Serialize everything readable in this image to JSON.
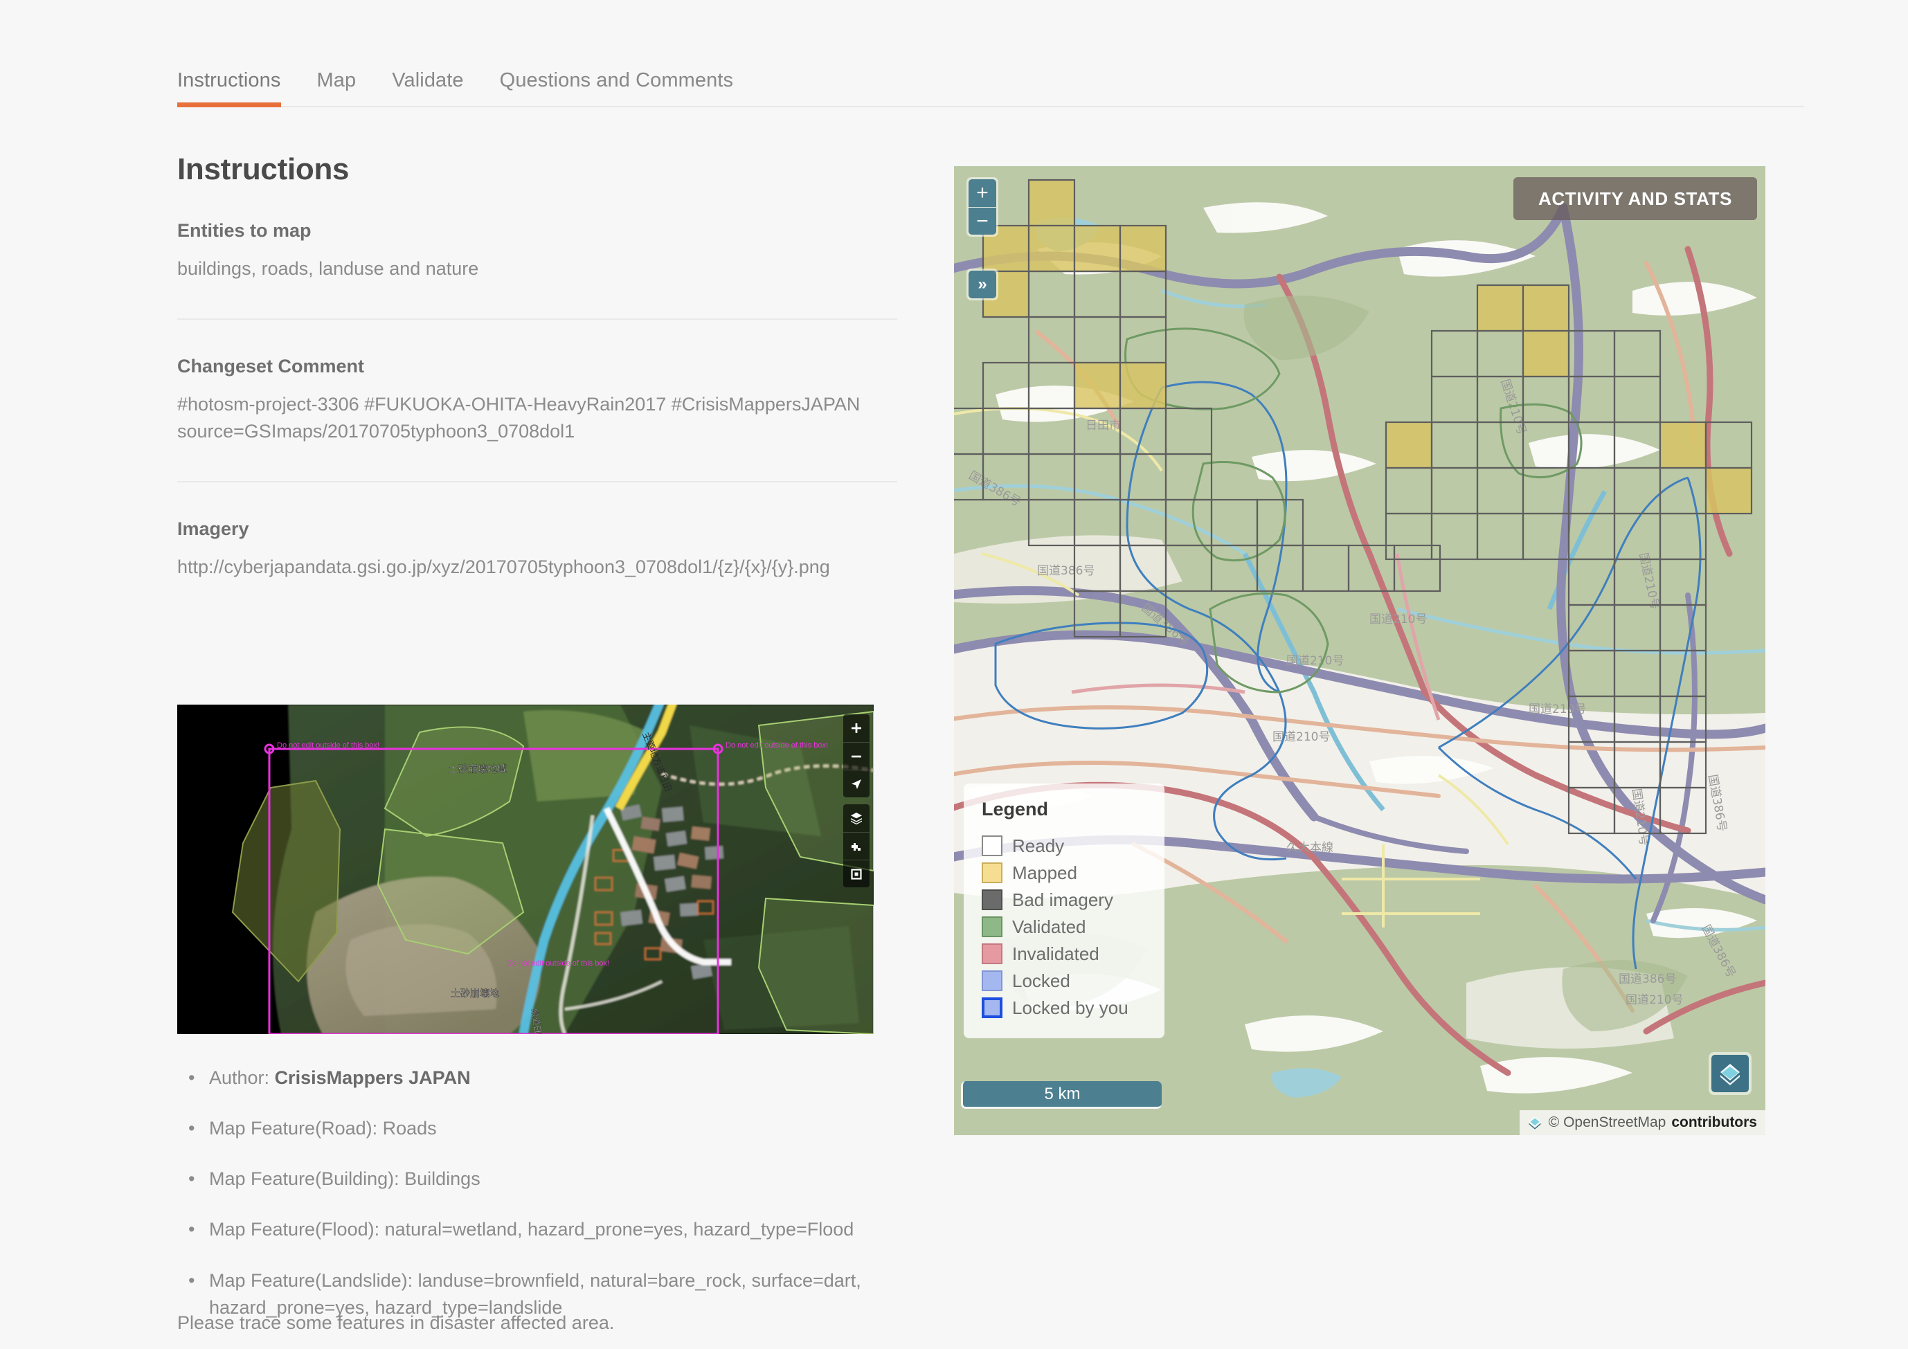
{
  "tabs": [
    {
      "label": "Instructions",
      "active": true
    },
    {
      "label": "Map",
      "active": false
    },
    {
      "label": "Validate",
      "active": false
    },
    {
      "label": "Questions and Comments",
      "active": false
    }
  ],
  "instructions": {
    "title": "Instructions",
    "entities": {
      "heading": "Entities to map",
      "text": "buildings, roads, landuse and nature"
    },
    "changeset": {
      "heading": "Changeset Comment",
      "line1": "#hotosm-project-3306 #FUKUOKA-OHITA-HeavyRain2017 #CrisisMappersJAPAN",
      "line2": "source=GSImaps/20170705typhoon3_0708dol1"
    },
    "imagery": {
      "heading": "Imagery",
      "url": "http://cyberjapandata.gsi.go.jp/xyz/20170705typhoon3_0708dol1/{z}/{x}/{y}.png"
    },
    "screenshot": {
      "warning_top_left": "Do not edit outside of this box!",
      "warning_top_right": "Do not edit outside of this box!",
      "warning_center": "Do not edit outside of this box!",
      "label_landslide_area_1": "土砂崩壊地域",
      "label_landslide_area_2": "土砂崩壊地",
      "label_road_vertical": "主要地方道日田"
    },
    "bullets": [
      {
        "prefix": "Author: ",
        "strong": "CrisisMappers JAPAN",
        "suffix": ""
      },
      {
        "prefix": "Map Feature(Road): Roads",
        "strong": "",
        "suffix": ""
      },
      {
        "prefix": "Map Feature(Building): Buildings",
        "strong": "",
        "suffix": ""
      },
      {
        "prefix": "Map Feature(Flood): natural=wetland, hazard_prone=yes, hazard_type=Flood",
        "strong": "",
        "suffix": ""
      },
      {
        "prefix": "Map Feature(Landslide): landuse=brownfield, natural=bare_rock, surface=dart, hazard_prone=yes, hazard_type=landslide",
        "strong": "",
        "suffix": ""
      }
    ],
    "closing": "Please trace some features in disaster affected area."
  },
  "map": {
    "zoom_in_label": "+",
    "zoom_out_label": "−",
    "expand_label": "»",
    "stats_button": "ACTIVITY AND STATS",
    "scale_label": "5 km",
    "attribution_prefix": "© OpenStreetMap",
    "attribution_strong": "contributors",
    "legend": {
      "title": "Legend",
      "items": [
        {
          "label": "Ready",
          "fill": "#ffffff",
          "border": "#8a8a8a"
        },
        {
          "label": "Mapped",
          "fill": "#f5dd92",
          "border": "#c9ae5c"
        },
        {
          "label": "Bad imagery",
          "fill": "#6b6b6b",
          "border": "#4e4e4e"
        },
        {
          "label": "Validated",
          "fill": "#8eb887",
          "border": "#6a9563"
        },
        {
          "label": "Invalidated",
          "fill": "#e59aa2",
          "border": "#c47982"
        },
        {
          "label": "Locked",
          "fill": "#a4b7ee",
          "border": "#8296d6"
        },
        {
          "label": "Locked by you",
          "fill": "#a4b7ee",
          "border": "#1d4ede"
        }
      ]
    },
    "colors": {
      "land": "#bcc9a6",
      "urban": "#f4f2ec",
      "water": "#8fc4d8",
      "motorway": "#8e8bb0",
      "trunk": "#c4757a",
      "secondary": "#e2b49a",
      "task_mapped": "#d8c563",
      "task_grid_border": "#5e5e5e",
      "accent_teal": "#4c7f8f",
      "accent_orange": "#e8703a"
    }
  }
}
